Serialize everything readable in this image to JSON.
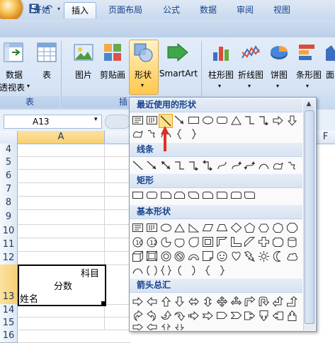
{
  "tabs": [
    "开始",
    "插入",
    "页面布局",
    "公式",
    "数据",
    "审阅",
    "视图"
  ],
  "active_tab": "插入",
  "ribbon": {
    "pivot_label_1": "数据",
    "pivot_label_2": "透视表",
    "table_label": "表",
    "tables_group": "表",
    "picture": "图片",
    "clipart": "剪贴画",
    "shapes": "形状",
    "smartart": "SmartArt",
    "illus_group": "插",
    "bar": "柱形图",
    "line": "折线图",
    "pie": "饼图",
    "barh": "条形图",
    "area": "面"
  },
  "formula": {
    "name_box": "A13"
  },
  "grid": {
    "columns": [
      "A",
      "E",
      "F"
    ],
    "rows": [
      "4",
      "5",
      "6",
      "7",
      "8",
      "9",
      "10",
      "11",
      "12",
      "13",
      "14",
      "15",
      "16"
    ],
    "cell_a13_lines": [
      "科目",
      "分数",
      "姓名"
    ]
  },
  "dropdown": {
    "sections": [
      "最近使用的形状",
      "线条",
      "矩形",
      "基本形状",
      "箭头总汇"
    ]
  },
  "icons": {
    "recent": [
      "text-box",
      "vertical-text",
      "line",
      "arrow-line",
      "rectangle",
      "oval",
      "rounded-rect",
      "triangle",
      "elbow",
      "elbow-arrow",
      "right-arrow",
      "down-arrow",
      "freeform",
      "scribble",
      "arc",
      "left-brace",
      "right-brace"
    ],
    "lines": [
      "line",
      "arrow",
      "double-arrow",
      "elbow",
      "elbow-arrow",
      "elbow-double",
      "curve",
      "curve-arrow",
      "curve-double",
      "arc",
      "freeform",
      "scribble"
    ],
    "rects": [
      "rectangle",
      "rounded-rect",
      "snip-corner",
      "snip-same",
      "snip-diag",
      "snip-round",
      "round-corner",
      "round-same",
      "round-diag"
    ],
    "basic_row1": [
      "text-box",
      "vertical-text",
      "oval",
      "triangle",
      "right-triangle",
      "parallelogram",
      "trapezoid",
      "diamond",
      "pentagon",
      "hexagon",
      "heptagon",
      "octagon"
    ],
    "basic_row2": [
      "decagon",
      "dodecagon",
      "pie",
      "chord",
      "teardrop",
      "frame",
      "half-frame",
      "l-shape",
      "diagonal-stripe",
      "cross",
      "plaque",
      "can"
    ],
    "basic_row3": [
      "cube",
      "bevel",
      "donut",
      "no-symbol",
      "block-arc",
      "folded-corner",
      "smiley",
      "heart",
      "lightning",
      "sun",
      "moon",
      "cloud"
    ],
    "basic_row4": [
      "arc",
      "double-bracket",
      "double-brace",
      "left-bracket",
      "right-bracket",
      "left-brace",
      "right-brace"
    ],
    "arrows_row1": [
      "right-arrow",
      "left-arrow",
      "up-arrow",
      "down-arrow",
      "left-right-arrow",
      "up-down-arrow",
      "quad-arrow",
      "left-right-up",
      "bent-arrow",
      "u-turn",
      "left-up",
      "bent-up"
    ],
    "arrows_row2": [
      "curved-right",
      "curved-left",
      "curved-up",
      "curved-down",
      "striped-right",
      "notched-right",
      "pentagon-arrow",
      "chevron",
      "right-callout",
      "down-callout",
      "left-callout",
      "up-callout"
    ]
  },
  "colors": {
    "accent": "#15428b",
    "highlight": "#ffd87a",
    "pointer": "#e03020"
  }
}
